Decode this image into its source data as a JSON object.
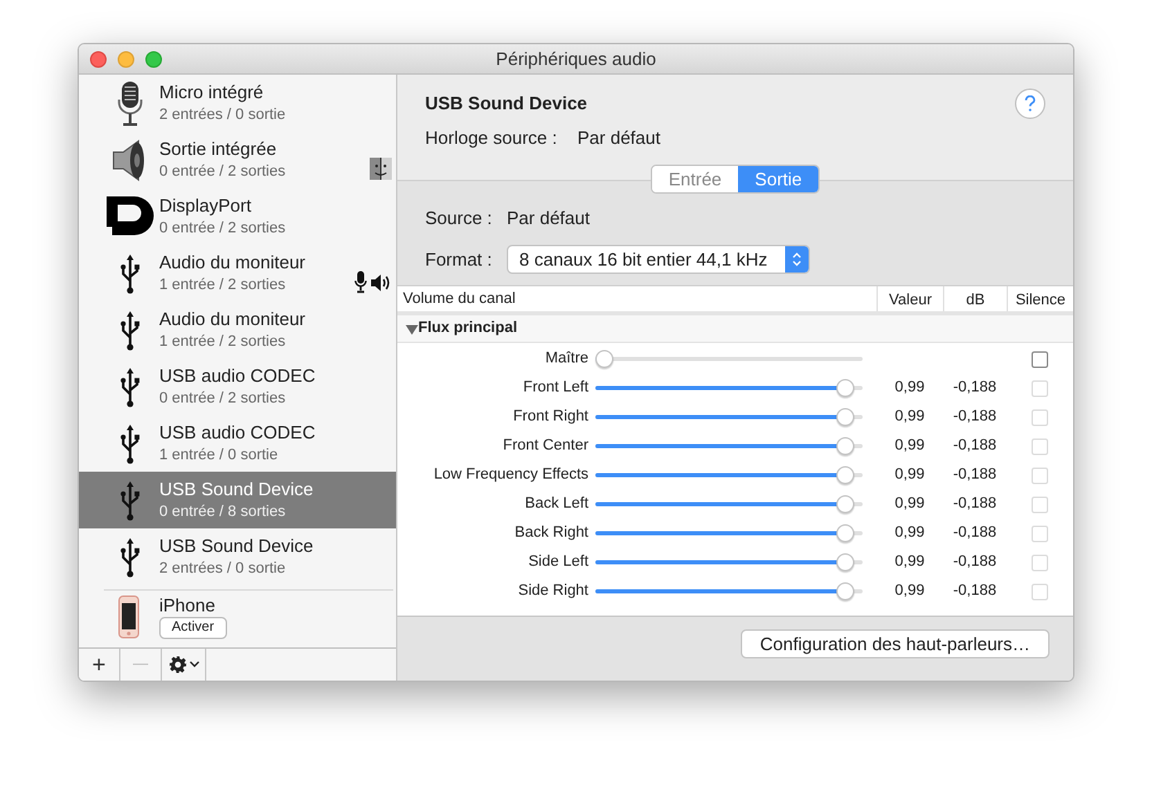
{
  "window": {
    "title": "Périphériques audio"
  },
  "devices": [
    {
      "kind": "mic",
      "name": "Micro intégré",
      "io": "2 entrées / 0 sortie",
      "selected": false,
      "default_system": false,
      "default_input": false,
      "default_output": false
    },
    {
      "kind": "speaker",
      "name": "Sortie intégrée",
      "io": "0 entrée / 2 sorties",
      "selected": false,
      "default_system": true,
      "default_input": false,
      "default_output": false
    },
    {
      "kind": "displayport",
      "name": "DisplayPort",
      "io": "0 entrée / 2 sorties",
      "selected": false,
      "default_system": false,
      "default_input": false,
      "default_output": false
    },
    {
      "kind": "usb",
      "name": "Audio du moniteur",
      "io": "1 entrée / 2 sorties",
      "selected": false,
      "default_system": false,
      "default_input": true,
      "default_output": true
    },
    {
      "kind": "usb",
      "name": "Audio du moniteur",
      "io": "1 entrée / 2 sorties",
      "selected": false,
      "default_system": false,
      "default_input": false,
      "default_output": false
    },
    {
      "kind": "usb",
      "name": "USB audio CODEC",
      "io": "0 entrée / 2 sorties",
      "selected": false,
      "default_system": false,
      "default_input": false,
      "default_output": false
    },
    {
      "kind": "usb",
      "name": "USB audio CODEC",
      "io": "1 entrée / 0 sortie",
      "selected": false,
      "default_system": false,
      "default_input": false,
      "default_output": false
    },
    {
      "kind": "usb",
      "name": "USB Sound Device",
      "io": "0 entrée / 8 sorties",
      "selected": true,
      "default_system": false,
      "default_input": false,
      "default_output": false
    },
    {
      "kind": "usb",
      "name": "USB Sound Device",
      "io": "2 entrées / 0 sortie",
      "selected": false,
      "default_system": false,
      "default_input": false,
      "default_output": false
    }
  ],
  "iphone": {
    "name": "iPhone",
    "button": "Activer"
  },
  "toolbar": {
    "add": "+",
    "remove": "—"
  },
  "detail": {
    "device_name": "USB Sound Device",
    "clock_label": "Horloge source :",
    "clock_value": "Par défaut",
    "tabs": [
      {
        "label": "Entrée",
        "selected": false
      },
      {
        "label": "Sortie",
        "selected": true
      }
    ],
    "source_label": "Source :",
    "source_value": "Par défaut",
    "format_label": "Format :",
    "format_value": "8 canaux 16 bit entier 44,1 kHz"
  },
  "table": {
    "columns": [
      "Volume du canal",
      "Valeur",
      "dB",
      "Silence"
    ],
    "group": "Flux principal",
    "group_expanded": true,
    "rows": [
      {
        "name": "Maître",
        "level": 0,
        "value": "",
        "db": "",
        "mute_checked": false,
        "mute_disabled": false
      },
      {
        "name": "Front Left",
        "level": 0.97,
        "value": "0,99",
        "db": "-0,188",
        "mute_checked": false,
        "mute_disabled": true
      },
      {
        "name": "Front Right",
        "level": 0.97,
        "value": "0,99",
        "db": "-0,188",
        "mute_checked": false,
        "mute_disabled": true
      },
      {
        "name": "Front Center",
        "level": 0.97,
        "value": "0,99",
        "db": "-0,188",
        "mute_checked": false,
        "mute_disabled": true
      },
      {
        "name": "Low Frequency Effects",
        "level": 0.97,
        "value": "0,99",
        "db": "-0,188",
        "mute_checked": false,
        "mute_disabled": true
      },
      {
        "name": "Back Left",
        "level": 0.97,
        "value": "0,99",
        "db": "-0,188",
        "mute_checked": false,
        "mute_disabled": true
      },
      {
        "name": "Back Right",
        "level": 0.97,
        "value": "0,99",
        "db": "-0,188",
        "mute_checked": false,
        "mute_disabled": true
      },
      {
        "name": "Side Left",
        "level": 0.97,
        "value": "0,99",
        "db": "-0,188",
        "mute_checked": false,
        "mute_disabled": true
      },
      {
        "name": "Side Right",
        "level": 0.97,
        "value": "0,99",
        "db": "-0,188",
        "mute_checked": false,
        "mute_disabled": true
      }
    ]
  },
  "speaker_config_button": "Configuration des haut-parleurs…"
}
